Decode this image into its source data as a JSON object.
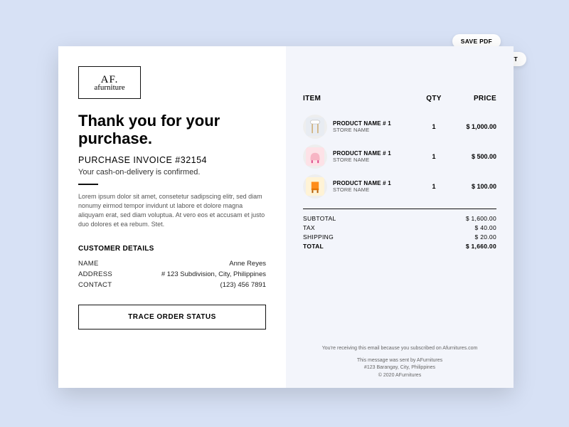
{
  "actions": {
    "save_pdf": "SAVE PDF",
    "print": "PRINT"
  },
  "logo": {
    "main": "AF.",
    "sub": "afurniture"
  },
  "left": {
    "thanks": "Thank you for your purchase.",
    "invoice": "PURCHASE INVOICE #32154",
    "confirm": "Your cash-on-delivery is confirmed.",
    "lorem": "Lorem ipsum dolor sit amet, consetetur sadipscing elitr, sed diam nonumy eirmod tempor invidunt ut labore et dolore magna aliquyam erat, sed diam voluptua. At vero eos et accusam et justo duo dolores et ea rebum. Stet.",
    "cd_title": "CUSTOMER DETAILS",
    "cd": [
      {
        "label": "NAME",
        "value": "Anne Reyes"
      },
      {
        "label": "ADDRESS",
        "value": "# 123 Subdivision, City, Philippines"
      },
      {
        "label": "CONTACT",
        "value": "(123) 456 7891"
      }
    ],
    "trace": "TRACE ORDER STATUS"
  },
  "right": {
    "headers": {
      "item": "ITEM",
      "qty": "QTY",
      "price": "PRICE"
    },
    "items": [
      {
        "name": "PRODUCT NAME # 1",
        "store": "STORE NAME",
        "qty": "1",
        "price": "$ 1,000.00"
      },
      {
        "name": "PRODUCT NAME # 1",
        "store": "STORE NAME",
        "qty": "1",
        "price": "$ 500.00"
      },
      {
        "name": "PRODUCT NAME # 1",
        "store": "STORE NAME",
        "qty": "1",
        "price": "$ 100.00"
      }
    ],
    "totals": [
      {
        "label": "SUBTOTAL",
        "value": "$ 1,600.00"
      },
      {
        "label": "TAX",
        "value": "$ 40.00"
      },
      {
        "label": "SHIPPING",
        "value": "$ 20.00"
      },
      {
        "label": "TOTAL",
        "value": "$ 1,660.00"
      }
    ],
    "footer1": "You're receiving this email because you subscribed on Afurnitures.com",
    "footer2": "This message was sent by AFurnitures",
    "footer3": "#123 Barangay, City, Philippines",
    "footer4": "© 2020 AFurnitures"
  }
}
